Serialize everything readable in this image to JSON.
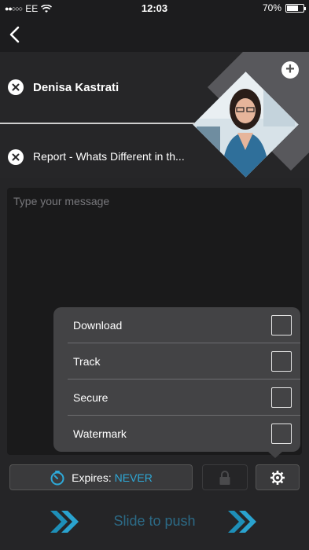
{
  "status_bar": {
    "carrier": "EE",
    "time": "12:03",
    "battery": "70%",
    "battery_level": 0.7
  },
  "recipient": {
    "name": "Denisa Kastrati"
  },
  "attachment": {
    "name": "Report - Whats Different in th..."
  },
  "message": {
    "placeholder": "Type your message"
  },
  "options": [
    {
      "label": "Download",
      "checked": false
    },
    {
      "label": "Track",
      "checked": false
    },
    {
      "label": "Secure",
      "checked": false
    },
    {
      "label": "Watermark",
      "checked": false
    }
  ],
  "toolbar": {
    "expires_label": "Expires:",
    "expires_value": "NEVER"
  },
  "slider": {
    "label": "Slide to push"
  },
  "colors": {
    "accent": "#2ea9d8",
    "slider_text": "#2c6a86"
  }
}
